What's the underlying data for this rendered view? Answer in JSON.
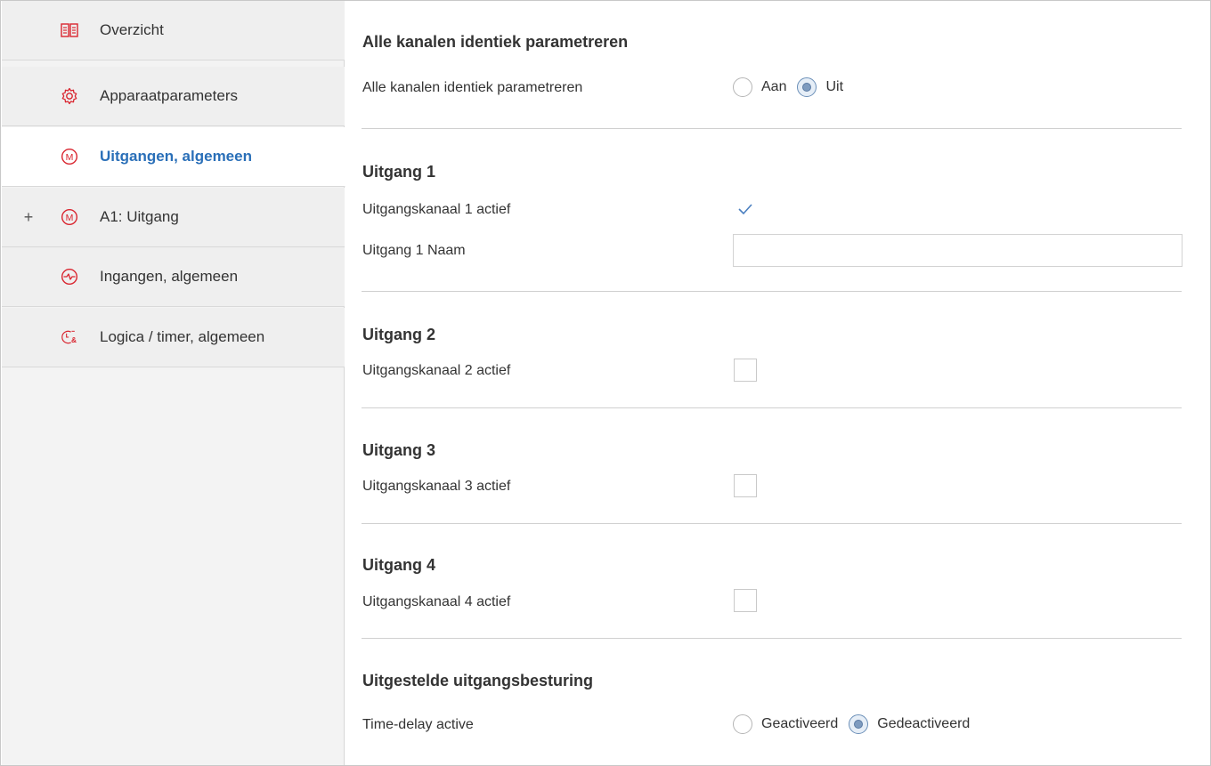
{
  "sidebar": {
    "items": [
      {
        "label": "Overzicht",
        "icon": "book-icon",
        "active": false,
        "expandable": false
      },
      {
        "label": "Apparaatparameters",
        "icon": "gear-icon",
        "active": false,
        "expandable": false
      },
      {
        "label": "Uitgangen, algemeen",
        "icon": "motor-m-icon",
        "active": true,
        "expandable": false
      },
      {
        "label": "A1: Uitgang",
        "icon": "motor-m-icon",
        "active": false,
        "expandable": true,
        "expand_symbol": "+"
      },
      {
        "label": "Ingangen, algemeen",
        "icon": "input-gauge-icon",
        "active": false,
        "expandable": false
      },
      {
        "label": "Logica / timer, algemeen",
        "icon": "logic-timer-icon",
        "active": false,
        "expandable": false
      }
    ]
  },
  "main": {
    "identical": {
      "title": "Alle kanalen identiek parametreren",
      "row_label": "Alle kanalen identiek parametreren",
      "options": [
        "Aan",
        "Uit"
      ],
      "selected": "Uit"
    },
    "outputs": [
      {
        "title": "Uitgang 1",
        "checkbox_label": "Uitgangskanaal 1 actief",
        "checked": true,
        "name_label": "Uitgang 1 Naam",
        "name_value": ""
      },
      {
        "title": "Uitgang 2",
        "checkbox_label": "Uitgangskanaal 2 actief",
        "checked": false
      },
      {
        "title": "Uitgang 3",
        "checkbox_label": "Uitgangskanaal 3 actief",
        "checked": false
      },
      {
        "title": "Uitgang 4",
        "checkbox_label": "Uitgangskanaal 4 actief",
        "checked": false
      }
    ],
    "delayed": {
      "title": "Uitgestelde uitgangsbesturing",
      "row_label": "Time-delay active",
      "options": [
        "Geactiveerd",
        "Gedeactiveerd"
      ],
      "selected": "Gedeactiveerd"
    }
  },
  "colors": {
    "accent_blue": "#2a6fb8",
    "icon_red": "#d9252f",
    "sidebar_bg": "#efefef"
  }
}
